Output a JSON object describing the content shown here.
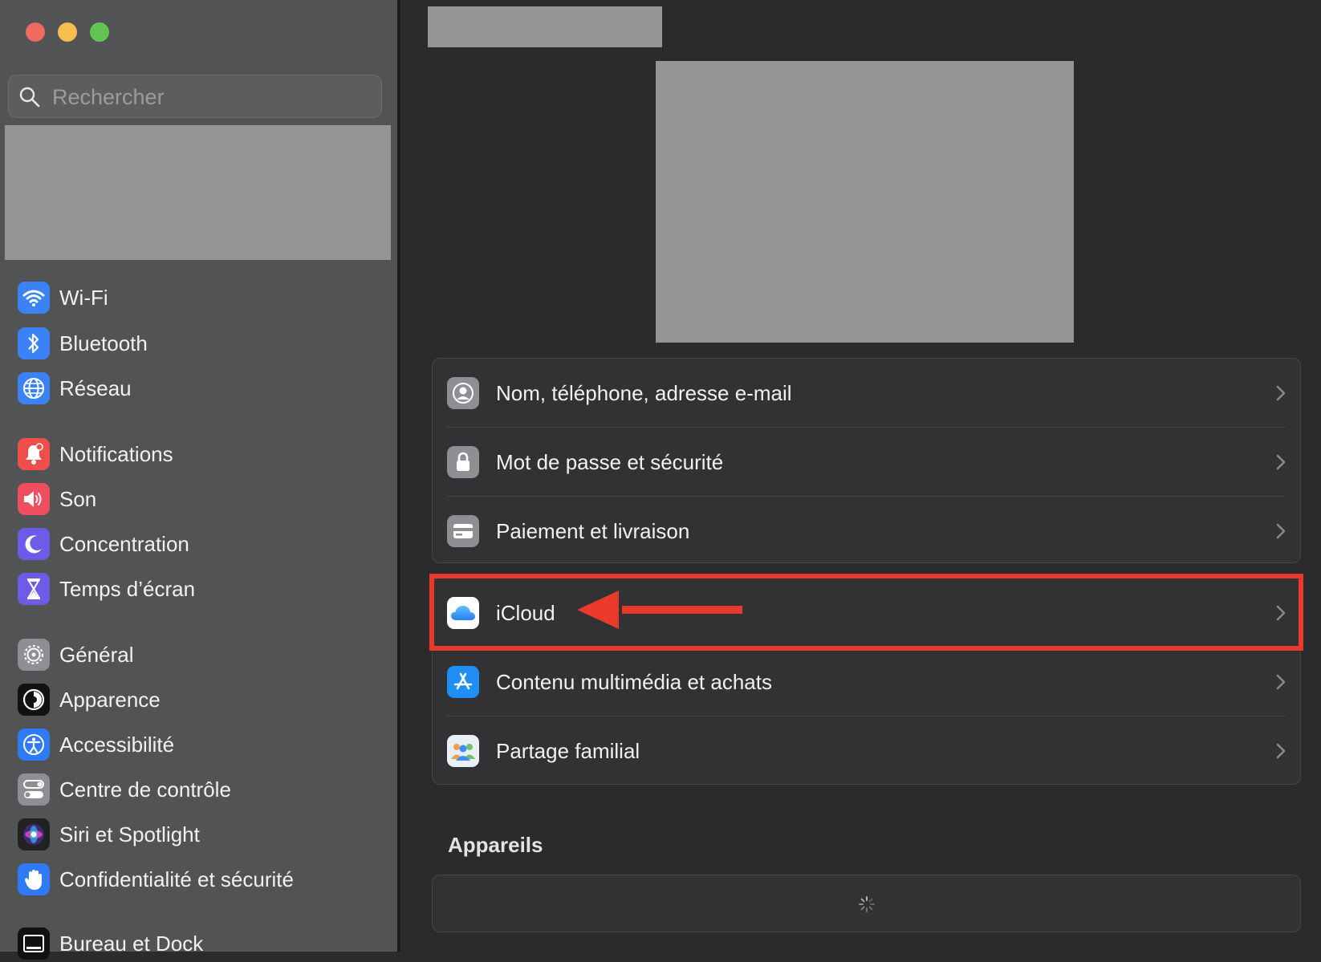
{
  "window": {
    "traffic_lights": {
      "close_color": "#ed6a5e",
      "minimize_color": "#f5bf4f",
      "maximize_color": "#61c554"
    }
  },
  "sidebar": {
    "search": {
      "placeholder": "Rechercher",
      "value": ""
    },
    "items": [
      {
        "label": "Wi-Fi",
        "icon": "wifi-icon",
        "color": "#3b82f6"
      },
      {
        "label": "Bluetooth",
        "icon": "bluetooth-icon",
        "color": "#3b82f6"
      },
      {
        "label": "Réseau",
        "icon": "globe-icon",
        "color": "#3b82f6"
      },
      {
        "label": "Notifications",
        "icon": "bell-icon",
        "color": "#ef4e4a"
      },
      {
        "label": "Son",
        "icon": "speaker-icon",
        "color": "#ef4e5e"
      },
      {
        "label": "Concentration",
        "icon": "moon-icon",
        "color": "#6d5ce7"
      },
      {
        "label": "Temps d’écran",
        "icon": "hourglass-icon",
        "color": "#6d5ce7"
      },
      {
        "label": "Général",
        "icon": "gear-icon",
        "color": "#8e8e93"
      },
      {
        "label": "Apparence",
        "icon": "appearance-icon",
        "color": "#111111"
      },
      {
        "label": "Accessibilité",
        "icon": "accessibility-icon",
        "color": "#2f7bf5"
      },
      {
        "label": "Centre de contrôle",
        "icon": "control-center-icon",
        "color": "#8e8e93"
      },
      {
        "label": "Siri et Spotlight",
        "icon": "siri-icon",
        "color": "#222222"
      },
      {
        "label": "Confidentialité et sécurité",
        "icon": "hand-icon",
        "color": "#2f7bf5"
      },
      {
        "label": "Bureau et Dock",
        "icon": "dock-icon",
        "color": "#111111"
      }
    ]
  },
  "main": {
    "account_rows": [
      {
        "label": "Nom, téléphone, adresse e-mail",
        "icon": "person-circle-icon"
      },
      {
        "label": "Mot de passe et sécurité",
        "icon": "lock-icon"
      },
      {
        "label": "Paiement et livraison",
        "icon": "credit-card-icon"
      }
    ],
    "services_rows": [
      {
        "label": "iCloud",
        "icon": "icloud-icon"
      },
      {
        "label": "Contenu multimédia et achats",
        "icon": "app-store-icon"
      },
      {
        "label": "Partage familial",
        "icon": "family-icon"
      }
    ],
    "devices_heading": "Appareils",
    "annotation_color": "#e8392a"
  }
}
